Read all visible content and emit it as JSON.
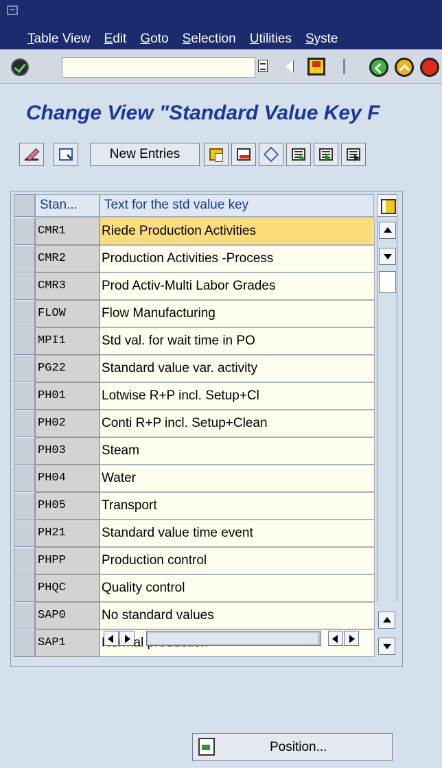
{
  "menubar": {
    "items": [
      "Table View",
      "Edit",
      "Goto",
      "Selection",
      "Utilities",
      "Syste"
    ]
  },
  "toolbar": {
    "command_value": ""
  },
  "title": "Change View \"Standard Value Key F",
  "app_toolbar": {
    "new_entries_label": "New Entries"
  },
  "table": {
    "columns": [
      "Stan...",
      "Text for the std value key"
    ],
    "rows": [
      {
        "key": "CMR1",
        "text": "Riede Production Activities"
      },
      {
        "key": "CMR2",
        "text": "Production Activities -Process"
      },
      {
        "key": "CMR3",
        "text": "Prod Activ-Multi Labor Grades"
      },
      {
        "key": "FLOW",
        "text": "Flow Manufacturing"
      },
      {
        "key": "MPI1",
        "text": "Std val. for wait time in PO"
      },
      {
        "key": "PG22",
        "text": "Standard value var. activity"
      },
      {
        "key": "PH01",
        "text": "Lotwise R+P incl. Setup+Cl"
      },
      {
        "key": "PH02",
        "text": "Conti R+P incl. Setup+Clean"
      },
      {
        "key": "PH03",
        "text": "Steam"
      },
      {
        "key": "PH04",
        "text": "Water"
      },
      {
        "key": "PH05",
        "text": "Transport"
      },
      {
        "key": "PH21",
        "text": "Standard value time event"
      },
      {
        "key": "PHPP",
        "text": "Production control"
      },
      {
        "key": "PHQC",
        "text": "Quality control"
      },
      {
        "key": "SAP0",
        "text": "No standard values"
      },
      {
        "key": "SAP1",
        "text": "Normal production"
      }
    ]
  },
  "position_button": {
    "label": "Position..."
  }
}
